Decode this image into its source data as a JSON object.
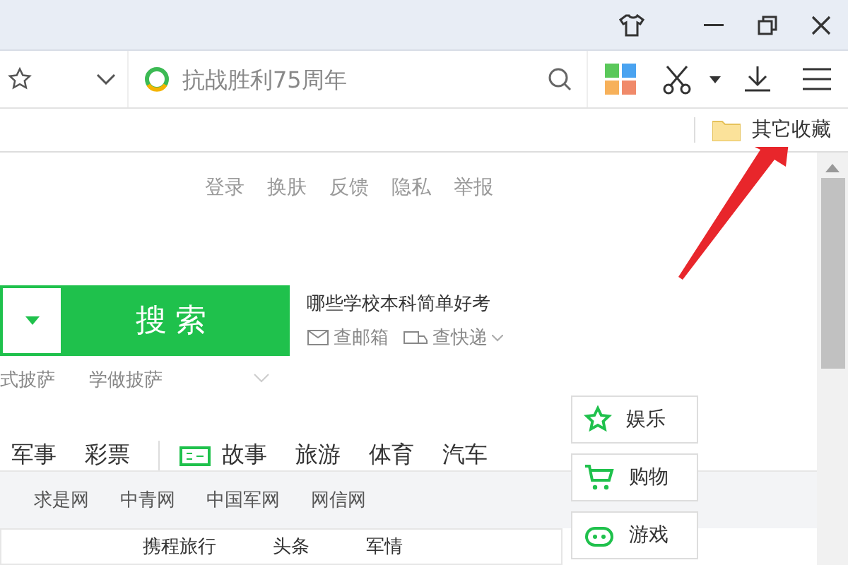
{
  "toolbar": {
    "search_placeholder": "抗战胜利75周年"
  },
  "bookmarks": [
    {
      "label": "其它收藏"
    }
  ],
  "top_links": [
    "登录",
    "换肤",
    "反馈",
    "隐私",
    "举报"
  ],
  "search": {
    "button": "搜索",
    "hint": "哪些学校本科简单好考",
    "mail": "查邮箱",
    "express": "查快递"
  },
  "suggestions": [
    "式披萨",
    "学做披萨"
  ],
  "nav": [
    {
      "label": "军事",
      "kind": "text"
    },
    {
      "label": "彩票",
      "kind": "text"
    },
    {
      "label": "故事",
      "kind": "icon"
    },
    {
      "label": "旅游",
      "kind": "text"
    },
    {
      "label": "体育",
      "kind": "text"
    },
    {
      "label": "汽车",
      "kind": "text"
    }
  ],
  "sites": [
    "求是网",
    "中青网",
    "中国军网",
    "网信网"
  ],
  "feed": [
    "携程旅行",
    "头条",
    "军情"
  ],
  "side_panel": [
    {
      "label": "娱乐",
      "kind": "star"
    },
    {
      "label": "购物",
      "kind": "cart"
    },
    {
      "label": "游戏",
      "kind": "game"
    }
  ]
}
